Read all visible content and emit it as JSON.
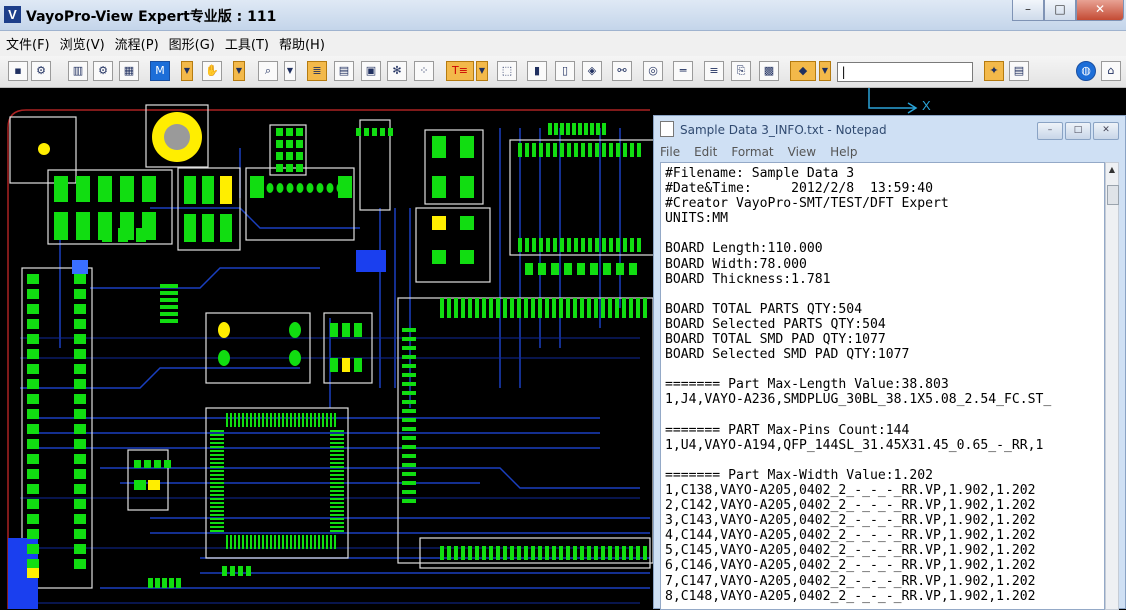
{
  "window": {
    "title": "VayoPro-View Expert专业版 : 111",
    "logo": "V",
    "minimize": "–",
    "maximize": "□",
    "close": "✕"
  },
  "menu": [
    "文件(F)",
    "浏览(V)",
    "流程(P)",
    "图形(G)",
    "工具(T)",
    "帮助(H)"
  ],
  "toolbar": {
    "m_button": "M",
    "te_button": "T≡",
    "search_value": "|"
  },
  "canvas": {
    "axis_label": "X",
    "colors": {
      "background": "#000000",
      "pads": "#11dd11",
      "selected_pads": "#ffee00",
      "traces": "#1a3fbf",
      "outline": "#e0e0e0",
      "board_edge": "#aa2222"
    }
  },
  "notepad": {
    "title": "Sample Data 3_INFO.txt - Notepad",
    "menu": [
      "File",
      "Edit",
      "Format",
      "View",
      "Help"
    ],
    "lines": [
      "#Filename: Sample Data 3",
      "#Date&Time:     2012/2/8  13:59:40",
      "#Creator VayoPro-SMT/TEST/DFT Expert",
      "UNITS:MM",
      "",
      "BOARD Length:110.000",
      "BOARD Width:78.000",
      "BOARD Thickness:1.781",
      "",
      "BOARD TOTAL PARTS QTY:504",
      "BOARD Selected PARTS QTY:504",
      "BOARD TOTAL SMD PAD QTY:1077",
      "BOARD Selected SMD PAD QTY:1077",
      "",
      "======= Part Max-Length Value:38.803",
      "1,J4,VAYO-A236,SMDPLUG_30BL_38.1X5.08_2.54_FC.ST_",
      "",
      "======= PART Max-Pins Count:144",
      "1,U4,VAYO-A194,QFP_144SL_31.45X31.45_0.65_-_RR,1",
      "",
      "======= Part Max-Width Value:1.202",
      "1,C138,VAYO-A205,0402_2_-_-_-_RR.VP,1.902,1.202",
      "2,C142,VAYO-A205,0402_2_-_-_-_RR.VP,1.902,1.202",
      "3,C143,VAYO-A205,0402_2_-_-_-_RR.VP,1.902,1.202",
      "4,C144,VAYO-A205,0402_2_-_-_-_RR.VP,1.902,1.202",
      "5,C145,VAYO-A205,0402_2_-_-_-_RR.VP,1.902,1.202",
      "6,C146,VAYO-A205,0402_2_-_-_-_RR.VP,1.902,1.202",
      "7,C147,VAYO-A205,0402_2_-_-_-_RR.VP,1.902,1.202",
      "8,C148,VAYO-A205,0402_2_-_-_-_RR.VP,1.902,1.202"
    ]
  }
}
